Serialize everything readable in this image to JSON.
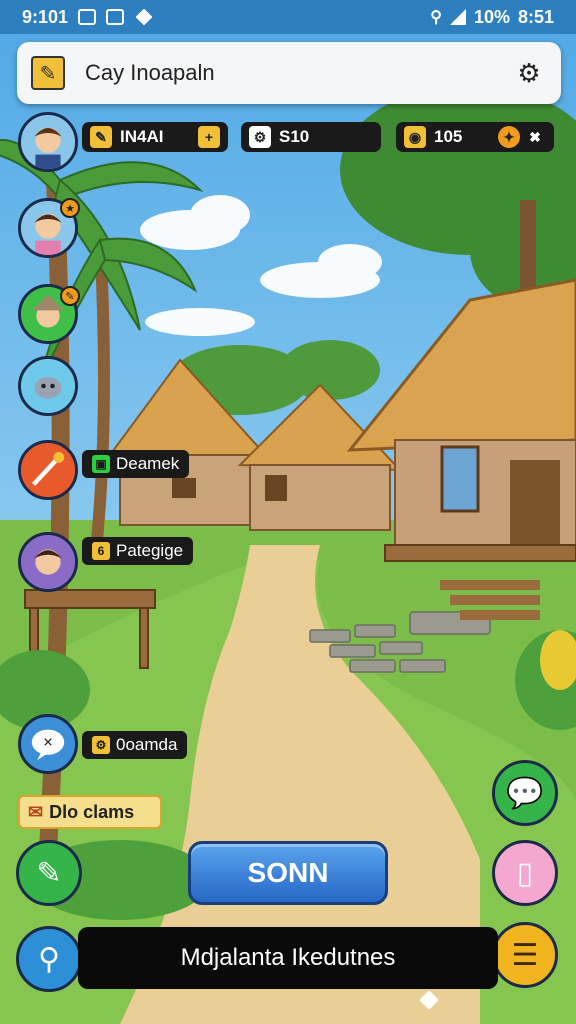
{
  "status_bar": {
    "time_left": "9:101",
    "battery": "10%",
    "time_right": "8:51"
  },
  "header": {
    "title": "Cay Inoapaln",
    "title_icon": "pencil-map-icon",
    "settings_icon": "gear-icon"
  },
  "resources": {
    "energy": {
      "value": "IN4AI",
      "icon": "scroll-icon"
    },
    "gear": {
      "value": "S10",
      "icon": "gear-icon"
    },
    "gold": {
      "value": "105",
      "icon": "coin-icon"
    }
  },
  "villagers": [
    {
      "name": "Deamek",
      "badge_color": "#2ecc40"
    },
    {
      "name": "Pategige",
      "badge_color": "#f2c037"
    },
    {
      "name": "0oamda",
      "badge_color": "#f2c037"
    }
  ],
  "claims_label": "Dlo clams",
  "sonn_button": "SONN",
  "bottom_bar_label": "Mdjalanta Ikedutnes",
  "colors": {
    "status_bar": "#2d7fc0",
    "primary_button": "#2767c7",
    "chat_button": "#35b44a",
    "clipboard_button": "#f4a7cf",
    "menu_button": "#f2b41e",
    "search_button": "#2d8fd6"
  }
}
